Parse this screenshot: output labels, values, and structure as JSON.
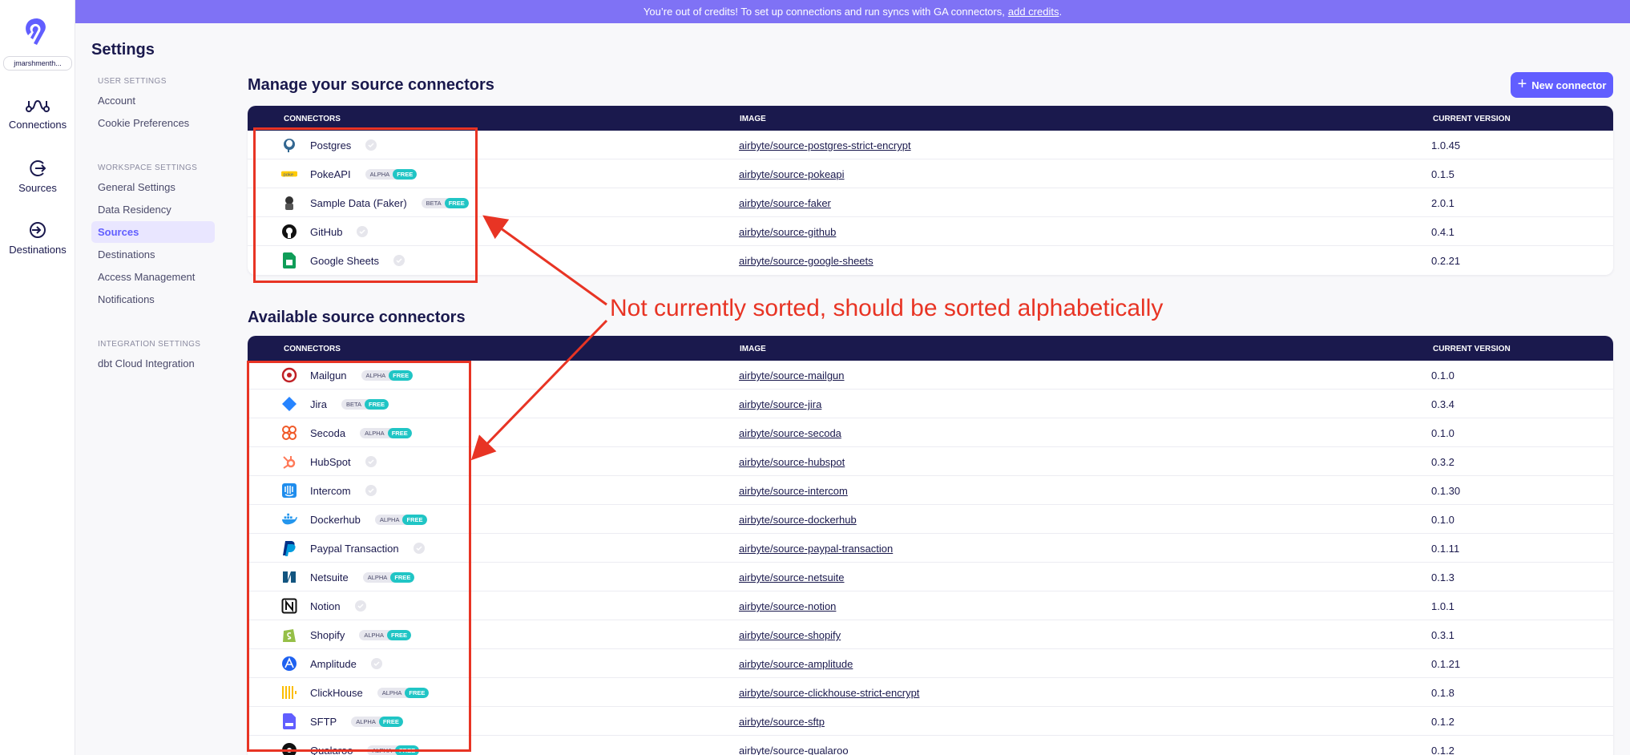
{
  "banner": {
    "text": "You’re out of credits! To set up connections and run syncs with GA connectors,",
    "link": "add credits",
    "period": "."
  },
  "workspace": {
    "name": "jmarshmenth..."
  },
  "nav": {
    "connections": "Connections",
    "sources": "Sources",
    "destinations": "Destinations"
  },
  "settings": {
    "title": "Settings",
    "user_group": "USER SETTINGS",
    "account": "Account",
    "cookie": "Cookie Preferences",
    "workspace_group": "WORKSPACE SETTINGS",
    "general": "General Settings",
    "residency": "Data Residency",
    "sources": "Sources",
    "destinations": "Destinations",
    "access": "Access Management",
    "notifications": "Notifications",
    "integration_group": "INTEGRATION SETTINGS",
    "dbt": "dbt Cloud Integration"
  },
  "manage": {
    "title": "Manage your source connectors",
    "new_button": "New connector",
    "col_connectors": "CONNECTORS",
    "col_image": "IMAGE",
    "col_version": "CURRENT VERSION",
    "rows": [
      {
        "name": "Postgres",
        "image": "airbyte/source-postgres-strict-encrypt",
        "version": "1.0.45"
      },
      {
        "name": "PokeAPI",
        "stage": "ALPHA",
        "free": "FREE",
        "image": "airbyte/source-pokeapi",
        "version": "0.1.5"
      },
      {
        "name": "Sample Data (Faker)",
        "stage": "BETA",
        "free": "FREE",
        "image": "airbyte/source-faker",
        "version": "2.0.1"
      },
      {
        "name": "GitHub",
        "image": "airbyte/source-github",
        "version": "0.4.1"
      },
      {
        "name": "Google Sheets",
        "image": "airbyte/source-google-sheets",
        "version": "0.2.21"
      }
    ]
  },
  "available": {
    "title": "Available source connectors",
    "col_connectors": "CONNECTORS",
    "col_image": "IMAGE",
    "col_version": "CURRENT VERSION",
    "rows": [
      {
        "name": "Mailgun",
        "stage": "ALPHA",
        "free": "FREE",
        "image": "airbyte/source-mailgun",
        "version": "0.1.0"
      },
      {
        "name": "Jira",
        "stage": "BETA",
        "free": "FREE",
        "image": "airbyte/source-jira",
        "version": "0.3.4"
      },
      {
        "name": "Secoda",
        "stage": "ALPHA",
        "free": "FREE",
        "image": "airbyte/source-secoda",
        "version": "0.1.0"
      },
      {
        "name": "HubSpot",
        "image": "airbyte/source-hubspot",
        "version": "0.3.2"
      },
      {
        "name": "Intercom",
        "image": "airbyte/source-intercom",
        "version": "0.1.30"
      },
      {
        "name": "Dockerhub",
        "stage": "ALPHA",
        "free": "FREE",
        "image": "airbyte/source-dockerhub",
        "version": "0.1.0"
      },
      {
        "name": "Paypal Transaction",
        "image": "airbyte/source-paypal-transaction",
        "version": "0.1.11"
      },
      {
        "name": "Netsuite",
        "stage": "ALPHA",
        "free": "FREE",
        "image": "airbyte/source-netsuite",
        "version": "0.1.3"
      },
      {
        "name": "Notion",
        "image": "airbyte/source-notion",
        "version": "1.0.1"
      },
      {
        "name": "Shopify",
        "stage": "ALPHA",
        "free": "FREE",
        "image": "airbyte/source-shopify",
        "version": "0.3.1"
      },
      {
        "name": "Amplitude",
        "image": "airbyte/source-amplitude",
        "version": "0.1.21"
      },
      {
        "name": "ClickHouse",
        "stage": "ALPHA",
        "free": "FREE",
        "image": "airbyte/source-clickhouse-strict-encrypt",
        "version": "0.1.8"
      },
      {
        "name": "SFTP",
        "stage": "ALPHA",
        "free": "FREE",
        "image": "airbyte/source-sftp",
        "version": "0.1.2"
      },
      {
        "name": "Qualaroo",
        "stage": "ALPHA",
        "free": "FREE",
        "image": "airbyte/source-qualaroo",
        "version": "0.1.2"
      }
    ]
  },
  "annotation": {
    "text": "Not currently sorted, should be sorted alphabetically"
  },
  "colors": {
    "accent": "#615eff",
    "banner": "#7f72f5",
    "header": "#1a194d",
    "annotation": "#e83424",
    "free_badge": "#20c5c5"
  }
}
